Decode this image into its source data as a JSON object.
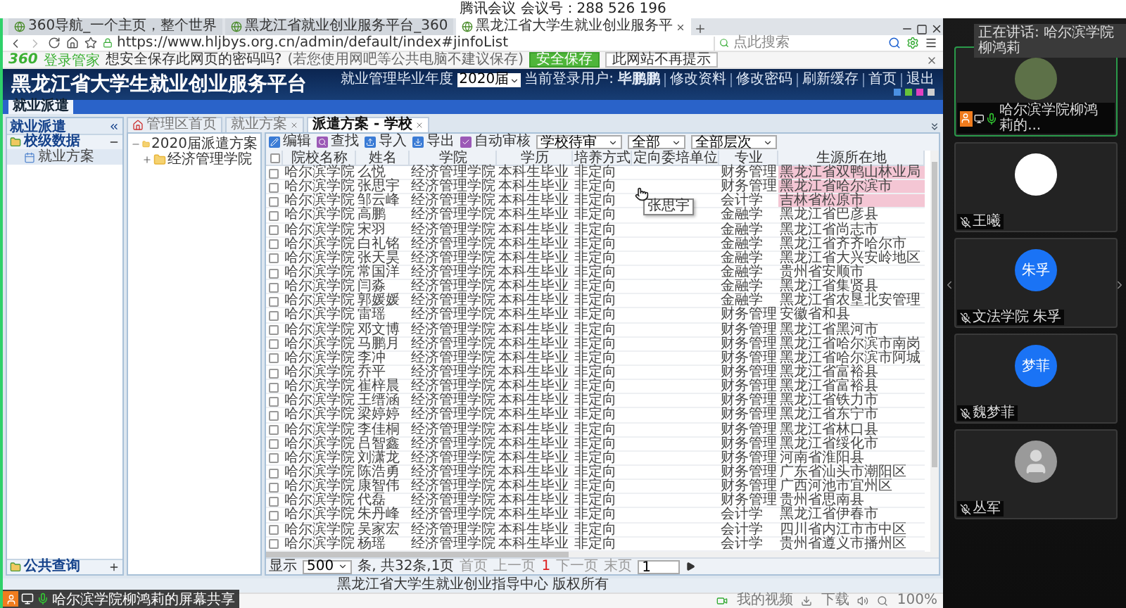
{
  "meeting": {
    "title": "腾讯会议 会议号：288 526 196"
  },
  "browser": {
    "tabs": [
      {
        "label": "360导航_一个主页，整个世界",
        "selected": false
      },
      {
        "label": "黑龙江省就业创业服务平台_360",
        "selected": false
      },
      {
        "label": "黑龙江省大学生就业创业服务平",
        "selected": true
      }
    ],
    "url": "https://www.hljbys.org.cn/admin/default/index#jinfoList",
    "search_placeholder": "点此搜索"
  },
  "password_bar": {
    "logo": "360",
    "brand": "登录管家",
    "message": "想安全保存此网页的密码吗?",
    "note": "(若您使用网吧等公共电脑不建议保存)",
    "buttons": [
      {
        "label": "安全保存",
        "kind": "primary"
      },
      {
        "label": "此网站不再提示",
        "kind": "plain"
      }
    ]
  },
  "site": {
    "title": "黑龙江省大学生就业创业服务平台",
    "year_label": "就业管理毕业年度",
    "year": "2020届",
    "user_label": "当前登录用户:",
    "user": "毕鹏鹏",
    "links": [
      "修改资料",
      "修改密码",
      "刷新缓存",
      "首页",
      "退出"
    ]
  },
  "nav": [
    {
      "label": "就业派遣",
      "selected": true
    }
  ],
  "sidebar": {
    "title": "就业派遣",
    "sections": [
      {
        "label": "校级数据",
        "expanded": true,
        "items": [
          {
            "label": "就业方案",
            "selected": true
          }
        ]
      },
      {
        "label": "公共查询",
        "expanded": false
      }
    ]
  },
  "panel_tabs": [
    {
      "label": "管理区首页",
      "selected": false,
      "closable": false
    },
    {
      "label": "就业方案",
      "selected": false,
      "closable": true
    },
    {
      "label": "派遣方案 - 学校",
      "selected": true,
      "closable": true
    }
  ],
  "tree": [
    {
      "label": "2020届派遣方案",
      "expanded": true,
      "children": [
        {
          "label": "经济管理学院",
          "expanded": false
        }
      ]
    }
  ],
  "toolbar": {
    "buttons": [
      {
        "label": "编辑",
        "kind": "edit"
      },
      {
        "label": "查找",
        "kind": "find"
      },
      {
        "label": "导入",
        "kind": "import"
      },
      {
        "label": "导出",
        "kind": "export"
      },
      {
        "label": "自动审核",
        "kind": "audit"
      }
    ],
    "filters": [
      "学校待审",
      "全部",
      "全部层次"
    ]
  },
  "table": {
    "all_checked": false,
    "columns": [
      "院校名称",
      "姓名",
      "学院",
      "学历",
      "培养方式",
      "定向委培单位",
      "专业",
      "生源所在地"
    ],
    "rows": [
      {
        "checked": false,
        "highlighted": true,
        "school": "哈尔滨学院",
        "name": "么悦",
        "college": "经济管理学院",
        "degree": "本科生毕业",
        "training": "非定向",
        "major": "财务管理",
        "origin": "黑龙江省双鸭山林业局"
      },
      {
        "checked": false,
        "highlighted": true,
        "school": "哈尔滨学院",
        "name": "张思宇",
        "college": "经济管理学院",
        "degree": "本科生毕业",
        "training": "非定向",
        "major": "财务管理",
        "origin": "黑龙江省哈尔滨市"
      },
      {
        "checked": false,
        "highlighted": true,
        "school": "哈尔滨学院",
        "name": "邹云峰",
        "college": "经济管理学院",
        "degree": "本科生毕业",
        "training": "非定向",
        "major": "会计学",
        "origin": "吉林省松原市"
      },
      {
        "checked": false,
        "highlighted": false,
        "school": "哈尔滨学院",
        "name": "高鹏",
        "college": "经济管理学院",
        "degree": "本科生毕业",
        "training": "非定向",
        "major": "金融学",
        "origin": "黑龙江省巴彦县"
      },
      {
        "checked": false,
        "highlighted": false,
        "school": "哈尔滨学院",
        "name": "宋羽",
        "college": "经济管理学院",
        "degree": "本科生毕业",
        "training": "非定向",
        "major": "金融学",
        "origin": "黑龙江省尚志市"
      },
      {
        "checked": false,
        "highlighted": false,
        "school": "哈尔滨学院",
        "name": "白礼铭",
        "college": "经济管理学院",
        "degree": "本科生毕业",
        "training": "非定向",
        "major": "金融学",
        "origin": "黑龙江省齐齐哈尔市"
      },
      {
        "checked": false,
        "highlighted": false,
        "school": "哈尔滨学院",
        "name": "张天昊",
        "college": "经济管理学院",
        "degree": "本科生毕业",
        "training": "非定向",
        "major": "金融学",
        "origin": "黑龙江省大兴安岭地区"
      },
      {
        "checked": false,
        "highlighted": false,
        "school": "哈尔滨学院",
        "name": "常国洋",
        "college": "经济管理学院",
        "degree": "本科生毕业",
        "training": "非定向",
        "major": "金融学",
        "origin": "贵州省安顺市"
      },
      {
        "checked": false,
        "highlighted": false,
        "school": "哈尔滨学院",
        "name": "闫淼",
        "college": "经济管理学院",
        "degree": "本科生毕业",
        "training": "非定向",
        "major": "金融学",
        "origin": "黑龙江省集贤县"
      },
      {
        "checked": false,
        "highlighted": false,
        "school": "哈尔滨学院",
        "name": "郭媛媛",
        "college": "经济管理学院",
        "degree": "本科生毕业",
        "training": "非定向",
        "major": "金融学",
        "origin": "黑龙江省农垦北安管理"
      },
      {
        "checked": false,
        "highlighted": false,
        "school": "哈尔滨学院",
        "name": "雷瑶",
        "college": "经济管理学院",
        "degree": "本科生毕业",
        "training": "非定向",
        "major": "财务管理",
        "origin": "安徽省和县"
      },
      {
        "checked": false,
        "highlighted": false,
        "school": "哈尔滨学院",
        "name": "邓文博",
        "college": "经济管理学院",
        "degree": "本科生毕业",
        "training": "非定向",
        "major": "财务管理",
        "origin": "黑龙江省黑河市"
      },
      {
        "checked": false,
        "highlighted": false,
        "school": "哈尔滨学院",
        "name": "马鹏月",
        "college": "经济管理学院",
        "degree": "本科生毕业",
        "training": "非定向",
        "major": "财务管理",
        "origin": "黑龙江省哈尔滨市南岗"
      },
      {
        "checked": false,
        "highlighted": false,
        "school": "哈尔滨学院",
        "name": "李冲",
        "college": "经济管理学院",
        "degree": "本科生毕业",
        "training": "非定向",
        "major": "财务管理",
        "origin": "黑龙江省哈尔滨市阿城"
      },
      {
        "checked": false,
        "highlighted": false,
        "school": "哈尔滨学院",
        "name": "乔平",
        "college": "经济管理学院",
        "degree": "本科生毕业",
        "training": "非定向",
        "major": "财务管理",
        "origin": "黑龙江省富裕县"
      },
      {
        "checked": false,
        "highlighted": false,
        "school": "哈尔滨学院",
        "name": "崔梓晨",
        "college": "经济管理学院",
        "degree": "本科生毕业",
        "training": "非定向",
        "major": "财务管理",
        "origin": "黑龙江省富裕县"
      },
      {
        "checked": false,
        "highlighted": false,
        "school": "哈尔滨学院",
        "name": "王缙涵",
        "college": "经济管理学院",
        "degree": "本科生毕业",
        "training": "非定向",
        "major": "财务管理",
        "origin": "黑龙江省铁力市"
      },
      {
        "checked": false,
        "highlighted": false,
        "school": "哈尔滨学院",
        "name": "梁婷婷",
        "college": "经济管理学院",
        "degree": "本科生毕业",
        "training": "非定向",
        "major": "财务管理",
        "origin": "黑龙江省东宁市"
      },
      {
        "checked": false,
        "highlighted": false,
        "school": "哈尔滨学院",
        "name": "李佳桐",
        "college": "经济管理学院",
        "degree": "本科生毕业",
        "training": "非定向",
        "major": "财务管理",
        "origin": "黑龙江省林口县"
      },
      {
        "checked": false,
        "highlighted": false,
        "school": "哈尔滨学院",
        "name": "吕智鑫",
        "college": "经济管理学院",
        "degree": "本科生毕业",
        "training": "非定向",
        "major": "财务管理",
        "origin": "黑龙江省绥化市"
      },
      {
        "checked": false,
        "highlighted": false,
        "school": "哈尔滨学院",
        "name": "刘潇龙",
        "college": "经济管理学院",
        "degree": "本科生毕业",
        "training": "非定向",
        "major": "财务管理",
        "origin": "河南省淮阳县"
      },
      {
        "checked": false,
        "highlighted": false,
        "school": "哈尔滨学院",
        "name": "陈浩勇",
        "college": "经济管理学院",
        "degree": "本科生毕业",
        "training": "非定向",
        "major": "财务管理",
        "origin": "广东省汕头市潮阳区"
      },
      {
        "checked": false,
        "highlighted": false,
        "school": "哈尔滨学院",
        "name": "康智伟",
        "college": "经济管理学院",
        "degree": "本科生毕业",
        "training": "非定向",
        "major": "财务管理",
        "origin": "广西河池市宜州区"
      },
      {
        "checked": false,
        "highlighted": false,
        "school": "哈尔滨学院",
        "name": "代磊",
        "college": "经济管理学院",
        "degree": "本科生毕业",
        "training": "非定向",
        "major": "财务管理",
        "origin": "贵州省思南县"
      },
      {
        "checked": false,
        "highlighted": false,
        "school": "哈尔滨学院",
        "name": "朱丹峰",
        "college": "经济管理学院",
        "degree": "本科生毕业",
        "training": "非定向",
        "major": "会计学",
        "origin": "黑龙江省伊春市"
      },
      {
        "checked": false,
        "highlighted": false,
        "school": "哈尔滨学院",
        "name": "吴家宏",
        "college": "经济管理学院",
        "degree": "本科生毕业",
        "training": "非定向",
        "major": "会计学",
        "origin": "四川省内江市市中区"
      },
      {
        "checked": false,
        "highlighted": false,
        "school": "哈尔滨学院",
        "name": "杨瑶",
        "college": "经济管理学院",
        "degree": "本科生毕业",
        "training": "非定向",
        "major": "会计学",
        "origin": "贵州省遵义市播州区"
      }
    ],
    "tooltip": "张思宇"
  },
  "pagination": {
    "show_label": "显示",
    "page_size": "500",
    "summary": "条, 共32条,1页",
    "first": "首页",
    "prev": "上一页",
    "current": "1",
    "next": "下一页",
    "last": "末页",
    "page_input": "1"
  },
  "footer": "黑龙江省大学生就业创业指导中心 版权所有",
  "status_bar": {
    "video": "我的视频",
    "download": "下载",
    "zoom": "100%"
  },
  "meeting_panel": {
    "speaking": "正在讲话: 哈尔滨学院柳鸿莉",
    "participants": [
      {
        "name": "哈尔滨学院柳鸿莉的...",
        "kind": "photo",
        "active": true,
        "muted": false,
        "sharing": true
      },
      {
        "name": "王曦",
        "kind": "cartoon",
        "active": false,
        "muted": true,
        "sharing": false
      },
      {
        "name": "文法学院 朱孚",
        "kind": "initials",
        "initials": "朱孚",
        "active": false,
        "muted": true,
        "sharing": false
      },
      {
        "name": "魏梦菲",
        "kind": "initials",
        "initials": "梦菲",
        "active": false,
        "muted": true,
        "sharing": false
      },
      {
        "name": "丛军",
        "kind": "default",
        "active": false,
        "muted": true,
        "sharing": false
      }
    ]
  },
  "share_label": "哈尔滨学院柳鸿莉的屏幕共享"
}
